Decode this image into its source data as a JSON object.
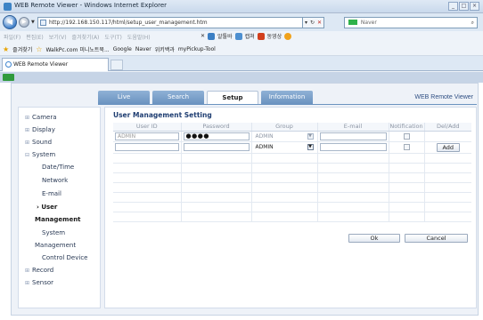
{
  "browser": {
    "title": "WEB Remote Viewer - Windows Internet Explorer",
    "window_buttons": [
      "_",
      "□",
      "×"
    ],
    "url": "http://192.168.150.117/html/setup_user_management.htm",
    "search_engine": "Naver",
    "menu": [
      "파일(F)",
      "편집(E)",
      "보기(V)",
      "즐겨찾기(A)",
      "도구(T)",
      "도움말(H)"
    ],
    "toolbar_right": [
      "알툴바",
      "캡쳐",
      "동영상"
    ],
    "favorites_label": "즐겨찾기",
    "favorites": [
      "WalkPc.com 미니노트북...",
      "Google",
      "Naver",
      "위키백과",
      "myPickup-Tool"
    ],
    "tab_label": "WEB Remote Viewer"
  },
  "app": {
    "brand": "WEB Remote Viewer",
    "tabs": [
      {
        "label": "Live",
        "active": false
      },
      {
        "label": "Search",
        "active": false
      },
      {
        "label": "Setup",
        "active": true
      },
      {
        "label": "Information",
        "active": false
      }
    ]
  },
  "sidebar": {
    "items": [
      "Camera",
      "Display",
      "Sound",
      "System",
      "Record",
      "Sensor"
    ],
    "system_sub": [
      "Date/Time",
      "Network",
      "E-mail",
      "User"
    ],
    "user_sub": [
      "Management",
      "System"
    ],
    "management": "Management",
    "control_device": "Control Device"
  },
  "form": {
    "title": "User Management Setting",
    "columns": [
      "User ID",
      "Password",
      "Group",
      "E-mail",
      "Notification",
      "Del/Add"
    ],
    "rows": [
      {
        "user_id": "ADMIN",
        "password": "●●●●",
        "group": "ADMIN",
        "email": "",
        "notification": false,
        "action": ""
      },
      {
        "user_id": "",
        "password": "",
        "group": "ADMIN",
        "email": "",
        "notification": false,
        "action": "Add"
      }
    ],
    "ok_label": "Ok",
    "cancel_label": "Cancel"
  }
}
